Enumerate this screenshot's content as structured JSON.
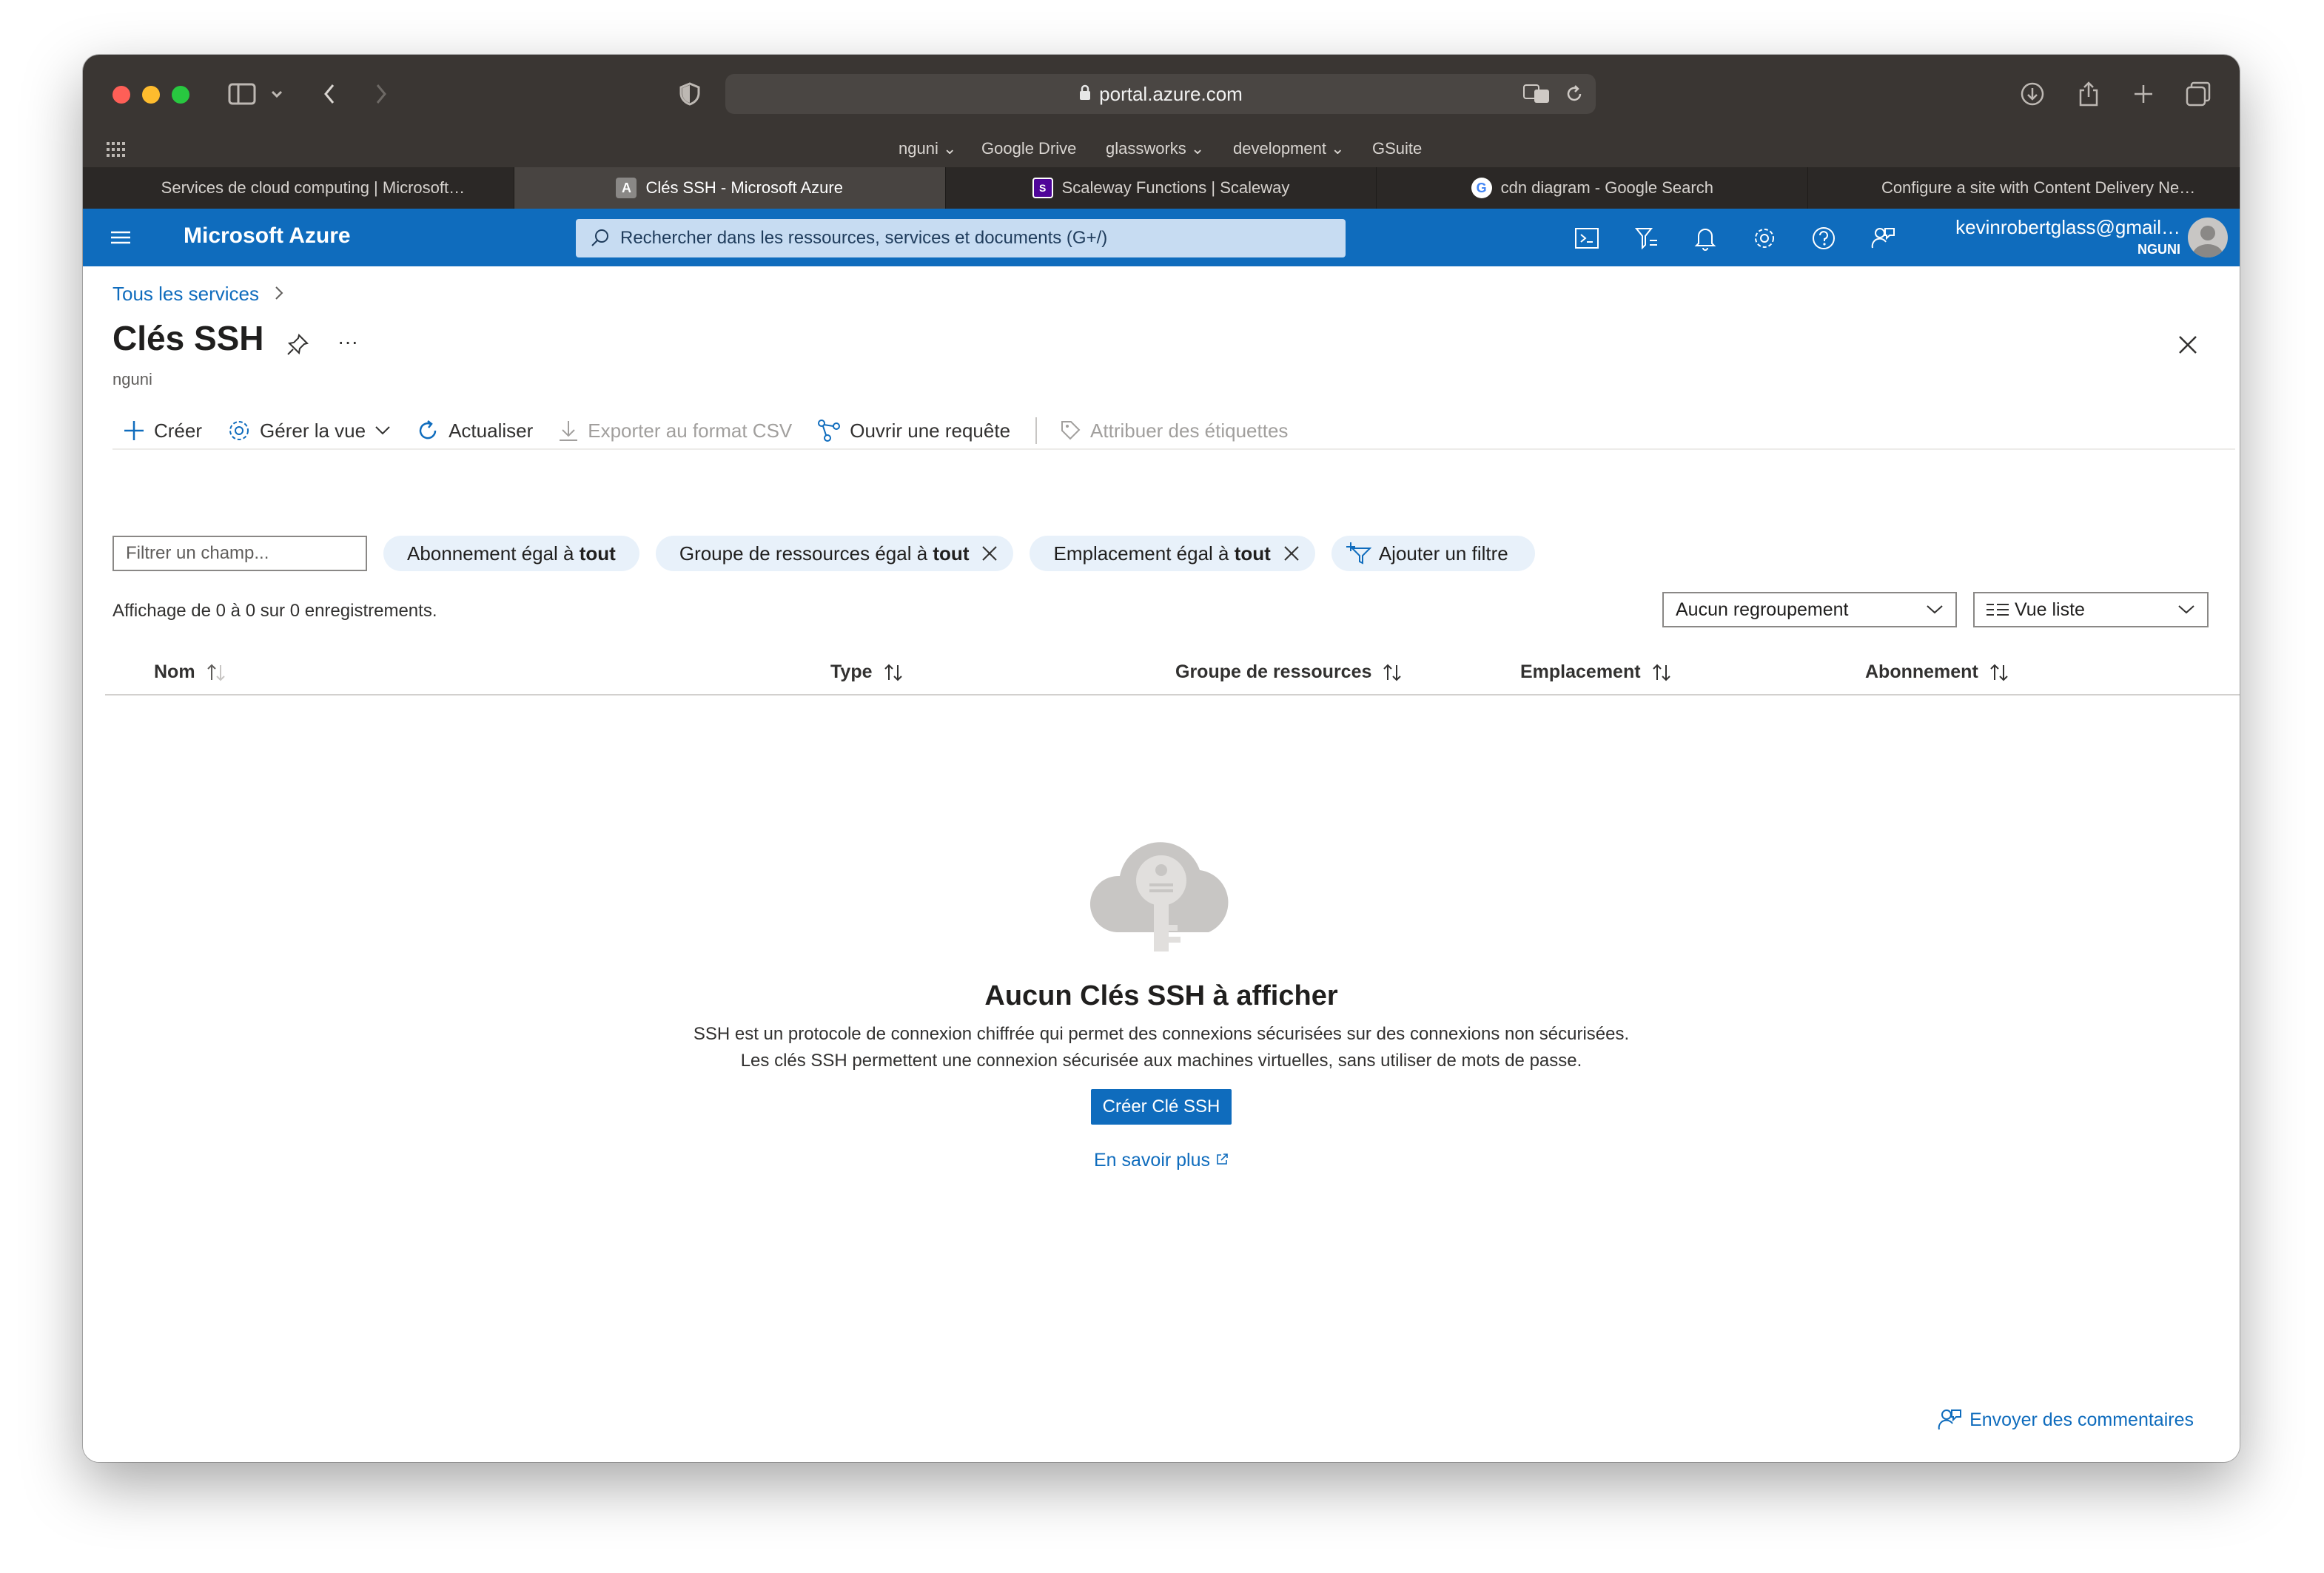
{
  "browser": {
    "url": "portal.azure.com",
    "bookmarks": [
      "nguni",
      "Google Drive",
      "glassworks",
      "development",
      "GSuite"
    ],
    "tabs": [
      {
        "label": "Services de cloud computing | Microsoft…",
        "icon": "microsoft-logo-icon"
      },
      {
        "label": "Clés SSH - Microsoft Azure",
        "icon": "azure-a-icon",
        "active": true
      },
      {
        "label": "Scaleway Functions | Scaleway",
        "icon": "scaleway-icon"
      },
      {
        "label": "cdn diagram - Google Search",
        "icon": "google-g-icon"
      },
      {
        "label": "Configure a site with Content Delivery Ne…",
        "icon": "microsoft-logo-icon"
      }
    ]
  },
  "azure": {
    "brand": "Microsoft Azure",
    "search_placeholder": "Rechercher dans les ressources, services et documents (G+/)",
    "user_email": "kevinrobertglass@gmail…",
    "tenant": "NGUNI"
  },
  "page": {
    "breadcrumb": "Tous les services",
    "title": "Clés SSH",
    "subtitle": "nguni",
    "commands": {
      "create": "Créer",
      "manage_view": "Gérer la vue",
      "refresh": "Actualiser",
      "export_csv": "Exporter au format CSV",
      "open_query": "Ouvrir une requête",
      "assign_tags": "Attribuer des étiquettes"
    },
    "filter_placeholder": "Filtrer un champ...",
    "filters": [
      {
        "label": "Abonnement égal à",
        "value": "tout"
      },
      {
        "label": "Groupe de ressources égal à",
        "value": "tout"
      },
      {
        "label": "Emplacement égal à",
        "value": "tout"
      }
    ],
    "add_filter": "Ajouter un filtre",
    "record_info": "Affichage de 0 à 0 sur 0 enregistrements.",
    "grouping": "Aucun regroupement",
    "view_mode": "Vue liste",
    "columns": [
      "Nom",
      "Type",
      "Groupe de ressources",
      "Emplacement",
      "Abonnement"
    ],
    "empty": {
      "heading": "Aucun Clés SSH à afficher",
      "line1": "SSH est un protocole de connexion chiffrée qui permet des connexions sécurisées sur des connexions non sécurisées.",
      "line2": "Les clés SSH permettent une connexion sécurisée aux machines virtuelles, sans utiliser de mots de passe.",
      "button": "Créer Clé SSH",
      "learn_more": "En savoir plus"
    },
    "feedback": "Envoyer des commentaires"
  }
}
